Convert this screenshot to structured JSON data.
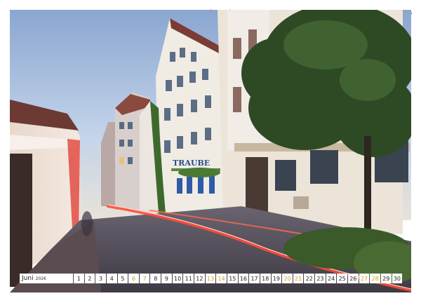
{
  "calendar": {
    "month": "Juni",
    "year": "2026",
    "days": [
      "1",
      "2",
      "3",
      "4",
      "5",
      "6",
      "7",
      "8",
      "9",
      "10",
      "11",
      "12",
      "13",
      "14",
      "15",
      "16",
      "17",
      "18",
      "19",
      "20",
      "21",
      "22",
      "23",
      "24",
      "25",
      "26",
      "27",
      "28",
      "29",
      "30"
    ],
    "weekend_days": [
      "6",
      "7",
      "13",
      "14",
      "20",
      "21",
      "27",
      "28"
    ]
  },
  "photo": {
    "sign_text": "TRAUBE"
  },
  "colors": {
    "weekend": "#c8a028",
    "light_trail": "#ff4a3a",
    "sky_top": "#9fb6d8"
  }
}
